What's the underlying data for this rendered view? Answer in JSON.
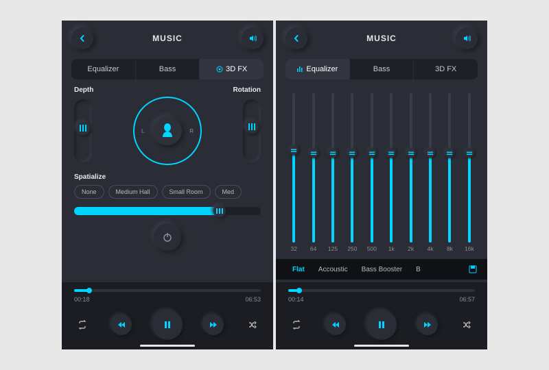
{
  "colors": {
    "accent": "#00d4ff",
    "bg": "#2a2d35",
    "panel": "#1b1d23"
  },
  "left": {
    "title": "MUSIC",
    "tabs": [
      {
        "label": "Equalizer",
        "active": false
      },
      {
        "label": "Bass",
        "active": false
      },
      {
        "label": "3D FX",
        "active": true,
        "icon": "target-icon"
      }
    ],
    "section_depth": "Depth",
    "section_rotation": "Rotation",
    "depth_value_pct": 55,
    "rotation_value_pct": 58,
    "dial": {
      "left_label": "L",
      "right_label": "R"
    },
    "spatialize_label": "Spatialize",
    "spatialize_options": [
      "None",
      "Medium Hall",
      "Small Room",
      "Med"
    ],
    "spatialize_slider_pct": 78,
    "player": {
      "elapsed": "00:18",
      "total": "06:53",
      "progress_pct": 8
    }
  },
  "right": {
    "title": "MUSIC",
    "tabs": [
      {
        "label": "Equalizer",
        "active": true,
        "icon": "equalizer-icon"
      },
      {
        "label": "Bass",
        "active": false
      },
      {
        "label": "3D FX",
        "active": false
      }
    ],
    "bands": [
      {
        "freq": "32",
        "value_pct": 62
      },
      {
        "freq": "64",
        "value_pct": 60
      },
      {
        "freq": "125",
        "value_pct": 60
      },
      {
        "freq": "250",
        "value_pct": 60
      },
      {
        "freq": "500",
        "value_pct": 60
      },
      {
        "freq": "1k",
        "value_pct": 60
      },
      {
        "freq": "2k",
        "value_pct": 60
      },
      {
        "freq": "4k",
        "value_pct": 60
      },
      {
        "freq": "8k",
        "value_pct": 60
      },
      {
        "freq": "16k",
        "value_pct": 60
      }
    ],
    "presets": [
      "Flat",
      "Accoustic",
      "Bass Booster",
      "B"
    ],
    "active_preset_index": 0,
    "player": {
      "elapsed": "00:14",
      "total": "06:57",
      "progress_pct": 6
    }
  }
}
